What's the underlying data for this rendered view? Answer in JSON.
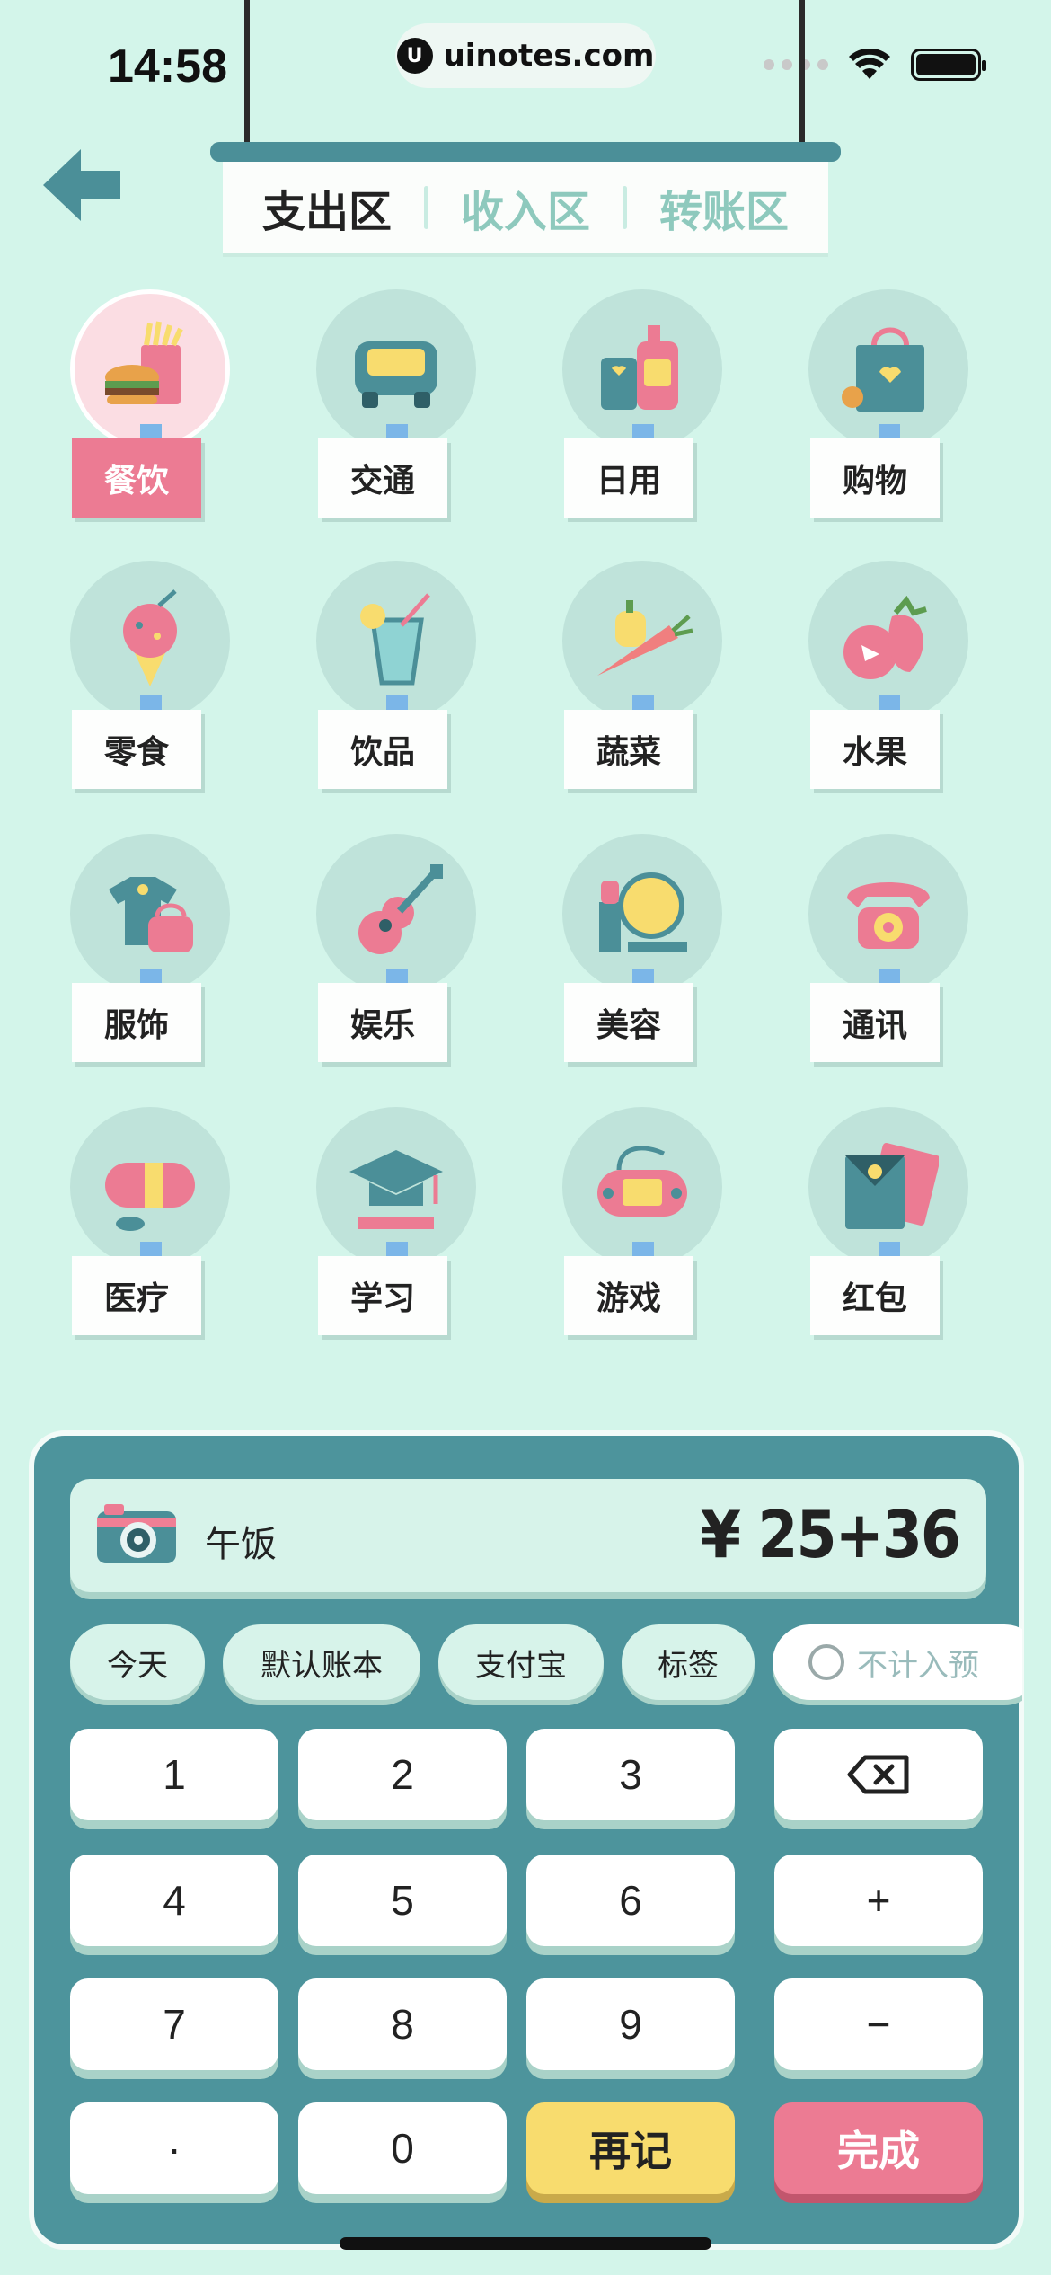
{
  "status_bar": {
    "time": "14:58",
    "url": "uinotes.com",
    "url_logo": "U"
  },
  "tabs": [
    {
      "label": "支出区",
      "active": true
    },
    {
      "label": "收入区",
      "active": false
    },
    {
      "label": "转账区",
      "active": false
    }
  ],
  "categories": [
    {
      "label": "餐饮",
      "icon": "burger-fries-icon",
      "selected": true
    },
    {
      "label": "交通",
      "icon": "car-icon",
      "selected": false
    },
    {
      "label": "日用",
      "icon": "lotion-bottle-icon",
      "selected": false
    },
    {
      "label": "购物",
      "icon": "shopping-bag-icon",
      "selected": false
    },
    {
      "label": "零食",
      "icon": "ice-cream-icon",
      "selected": false
    },
    {
      "label": "饮品",
      "icon": "drink-glass-icon",
      "selected": false
    },
    {
      "label": "蔬菜",
      "icon": "carrot-pepper-icon",
      "selected": false
    },
    {
      "label": "水果",
      "icon": "strawberry-icon",
      "selected": false
    },
    {
      "label": "服饰",
      "icon": "tshirt-handbag-icon",
      "selected": false
    },
    {
      "label": "娱乐",
      "icon": "guitar-icon",
      "selected": false
    },
    {
      "label": "美容",
      "icon": "compact-lipstick-icon",
      "selected": false
    },
    {
      "label": "通讯",
      "icon": "telephone-icon",
      "selected": false
    },
    {
      "label": "医疗",
      "icon": "pill-capsule-icon",
      "selected": false
    },
    {
      "label": "学习",
      "icon": "graduation-cap-icon",
      "selected": false
    },
    {
      "label": "游戏",
      "icon": "gamepad-icon",
      "selected": false
    },
    {
      "label": "红包",
      "icon": "red-envelope-icon",
      "selected": false
    }
  ],
  "entry": {
    "note": "午饭",
    "amount": "¥ 25+36"
  },
  "chips": {
    "date": "今天",
    "ledger": "默认账本",
    "account": "支付宝",
    "tag": "标签",
    "budget": "不计入预"
  },
  "keypad": {
    "k1": "1",
    "k2": "2",
    "k3": "3",
    "k4": "4",
    "k5": "5",
    "k6": "6",
    "k7": "7",
    "k8": "8",
    "k9": "9",
    "kdot": "·",
    "k0": "0",
    "plus": "+",
    "minus": "−",
    "again": "再记",
    "done": "完成"
  },
  "colors": {
    "background": "#d3f5ea",
    "panel": "#4d949c",
    "accent_pink": "#ec7b93",
    "accent_yellow": "#f8dc6e",
    "tab_inactive": "#8ec9bd"
  }
}
